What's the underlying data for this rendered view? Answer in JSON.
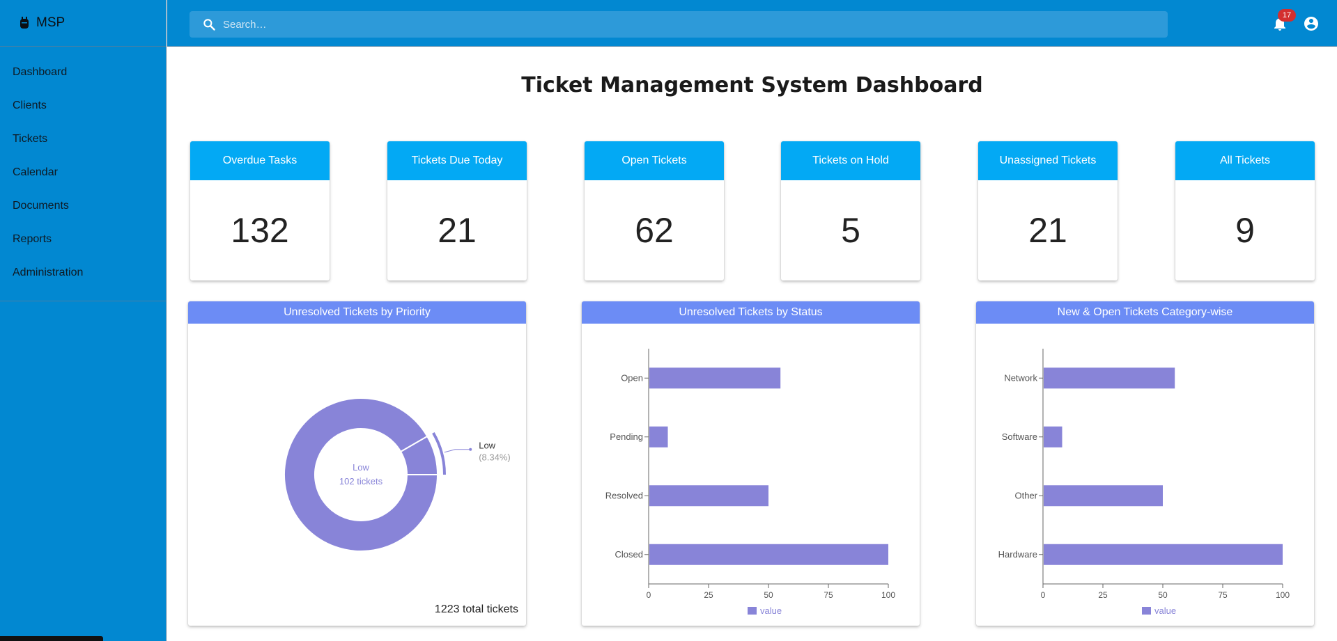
{
  "brand": {
    "name": "MSP"
  },
  "sidebar": {
    "items": [
      {
        "label": "Dashboard"
      },
      {
        "label": "Clients"
      },
      {
        "label": "Tickets"
      },
      {
        "label": "Calendar"
      },
      {
        "label": "Documents"
      },
      {
        "label": "Reports"
      },
      {
        "label": "Administration"
      }
    ]
  },
  "topbar": {
    "search_placeholder": "Search…",
    "notifications": "17"
  },
  "page": {
    "title": "Ticket Management System Dashboard"
  },
  "stats": [
    {
      "label": "Overdue Tasks",
      "value": "132"
    },
    {
      "label": "Tickets Due Today",
      "value": "21"
    },
    {
      "label": "Open Tickets",
      "value": "62"
    },
    {
      "label": "Tickets on Hold",
      "value": "5"
    },
    {
      "label": "Unassigned Tickets",
      "value": "21"
    },
    {
      "label": "All Tickets",
      "value": "9"
    }
  ],
  "colors": {
    "primary": "#0288d1",
    "stat_header": "#03a9f4",
    "chart_header": "#6c8cf5",
    "series": "#8884d8",
    "badge": "#d32f2f"
  },
  "chart_data": [
    {
      "type": "pie",
      "title": "Unresolved Tickets by Priority",
      "slices": [
        {
          "name": "",
          "value": 91.66
        },
        {
          "name": "Low",
          "value": 8.34
        }
      ],
      "center_label": "Low",
      "center_sub": "102 tickets",
      "callout_label": "Low",
      "callout_pct": "(8.34%)",
      "total_text": "1223 total tickets"
    },
    {
      "type": "bar",
      "orientation": "horizontal",
      "title": "Unresolved Tickets by Status",
      "categories": [
        "Open",
        "Pending",
        "Resolved",
        "Closed"
      ],
      "series": [
        {
          "name": "value",
          "values": [
            55,
            8,
            50,
            100
          ]
        }
      ],
      "xlim": [
        0,
        100
      ],
      "ticks": [
        "0",
        "25",
        "50",
        "75",
        "100"
      ],
      "legend": "bottom-center"
    },
    {
      "type": "bar",
      "orientation": "horizontal",
      "title": "New & Open Tickets Category-wise",
      "categories": [
        "Network",
        "Software",
        "Other",
        "Hardware"
      ],
      "series": [
        {
          "name": "value",
          "values": [
            55,
            8,
            50,
            100
          ]
        }
      ],
      "xlim": [
        0,
        100
      ],
      "ticks": [
        "0",
        "25",
        "50",
        "75",
        "100"
      ],
      "legend": "bottom-center"
    }
  ]
}
